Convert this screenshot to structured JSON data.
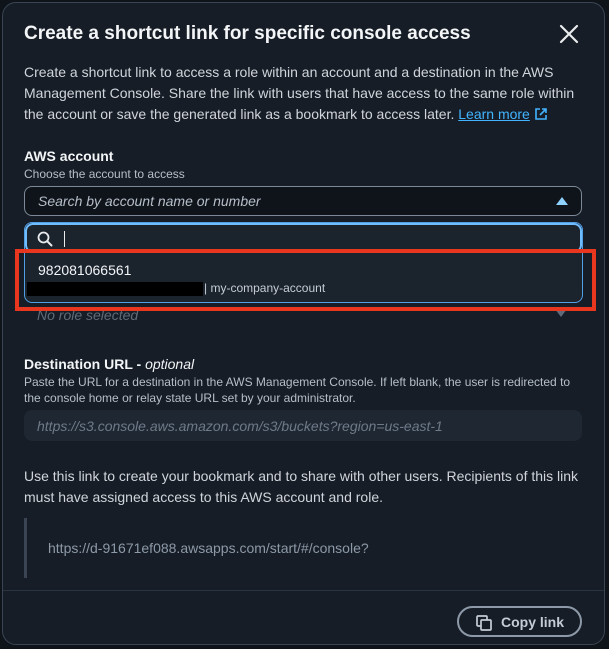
{
  "modal": {
    "title": "Create a shortcut link for specific console access",
    "intro": "Create a shortcut link to access a role within an account and a destination in the AWS Management Console. Share the link with users that have access to the same role within the account or save the generated link as a bookmark to access later.",
    "learn_more": "Learn more"
  },
  "aws_account": {
    "label": "AWS account",
    "description": "Choose the account to access",
    "placeholder": "Search by account name or number",
    "search_value": "",
    "option": {
      "number": "982081066561",
      "name": "| my-company-account"
    }
  },
  "role": {
    "placeholder": "No role selected"
  },
  "destination": {
    "label": "Destination URL - ",
    "label_optional": "optional",
    "description": "Paste the URL for a destination in the AWS Management Console. If left blank, the user is redirected to the console home or relay state URL set by your administrator.",
    "placeholder": "https://s3.console.aws.amazon.com/s3/buckets?region=us-east-1"
  },
  "share": {
    "text": "Use this link to create your bookmark and to share with other users. Recipients of this link must have assigned access to this AWS account and role.",
    "link": "https://d-91671ef088.awsapps.com/start/#/console?"
  },
  "footer": {
    "copy_label": "Copy link"
  },
  "icons": {
    "close": "close-icon",
    "external": "external-link-icon",
    "search": "search-icon",
    "copy": "copy-icon",
    "caret_up": "caret-up-icon"
  },
  "colors": {
    "accent": "#42b4ff",
    "highlight": "#e8371e",
    "background": "#161d26"
  }
}
